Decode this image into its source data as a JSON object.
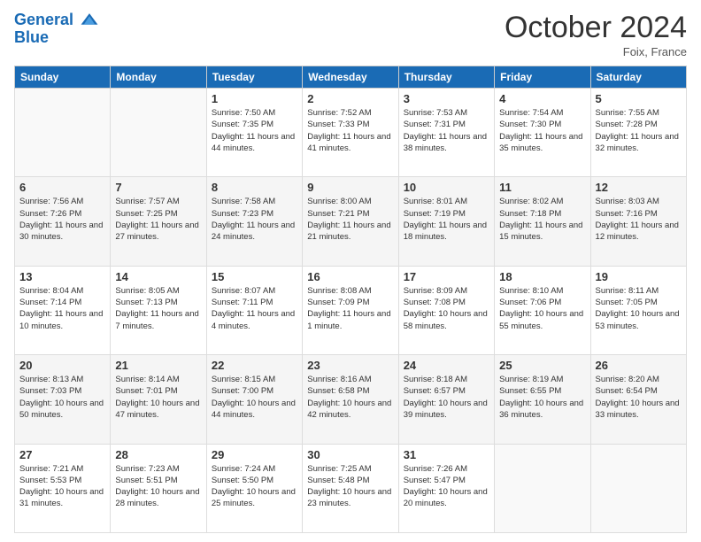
{
  "logo": {
    "line1": "General",
    "line2": "Blue"
  },
  "title": "October 2024",
  "location": "Foix, France",
  "days_of_week": [
    "Sunday",
    "Monday",
    "Tuesday",
    "Wednesday",
    "Thursday",
    "Friday",
    "Saturday"
  ],
  "weeks": [
    [
      {
        "day": "",
        "empty": true
      },
      {
        "day": "",
        "empty": true
      },
      {
        "day": "1",
        "sunrise": "Sunrise: 7:50 AM",
        "sunset": "Sunset: 7:35 PM",
        "daylight": "Daylight: 11 hours and 44 minutes."
      },
      {
        "day": "2",
        "sunrise": "Sunrise: 7:52 AM",
        "sunset": "Sunset: 7:33 PM",
        "daylight": "Daylight: 11 hours and 41 minutes."
      },
      {
        "day": "3",
        "sunrise": "Sunrise: 7:53 AM",
        "sunset": "Sunset: 7:31 PM",
        "daylight": "Daylight: 11 hours and 38 minutes."
      },
      {
        "day": "4",
        "sunrise": "Sunrise: 7:54 AM",
        "sunset": "Sunset: 7:30 PM",
        "daylight": "Daylight: 11 hours and 35 minutes."
      },
      {
        "day": "5",
        "sunrise": "Sunrise: 7:55 AM",
        "sunset": "Sunset: 7:28 PM",
        "daylight": "Daylight: 11 hours and 32 minutes."
      }
    ],
    [
      {
        "day": "6",
        "sunrise": "Sunrise: 7:56 AM",
        "sunset": "Sunset: 7:26 PM",
        "daylight": "Daylight: 11 hours and 30 minutes."
      },
      {
        "day": "7",
        "sunrise": "Sunrise: 7:57 AM",
        "sunset": "Sunset: 7:25 PM",
        "daylight": "Daylight: 11 hours and 27 minutes."
      },
      {
        "day": "8",
        "sunrise": "Sunrise: 7:58 AM",
        "sunset": "Sunset: 7:23 PM",
        "daylight": "Daylight: 11 hours and 24 minutes."
      },
      {
        "day": "9",
        "sunrise": "Sunrise: 8:00 AM",
        "sunset": "Sunset: 7:21 PM",
        "daylight": "Daylight: 11 hours and 21 minutes."
      },
      {
        "day": "10",
        "sunrise": "Sunrise: 8:01 AM",
        "sunset": "Sunset: 7:19 PM",
        "daylight": "Daylight: 11 hours and 18 minutes."
      },
      {
        "day": "11",
        "sunrise": "Sunrise: 8:02 AM",
        "sunset": "Sunset: 7:18 PM",
        "daylight": "Daylight: 11 hours and 15 minutes."
      },
      {
        "day": "12",
        "sunrise": "Sunrise: 8:03 AM",
        "sunset": "Sunset: 7:16 PM",
        "daylight": "Daylight: 11 hours and 12 minutes."
      }
    ],
    [
      {
        "day": "13",
        "sunrise": "Sunrise: 8:04 AM",
        "sunset": "Sunset: 7:14 PM",
        "daylight": "Daylight: 11 hours and 10 minutes."
      },
      {
        "day": "14",
        "sunrise": "Sunrise: 8:05 AM",
        "sunset": "Sunset: 7:13 PM",
        "daylight": "Daylight: 11 hours and 7 minutes."
      },
      {
        "day": "15",
        "sunrise": "Sunrise: 8:07 AM",
        "sunset": "Sunset: 7:11 PM",
        "daylight": "Daylight: 11 hours and 4 minutes."
      },
      {
        "day": "16",
        "sunrise": "Sunrise: 8:08 AM",
        "sunset": "Sunset: 7:09 PM",
        "daylight": "Daylight: 11 hours and 1 minute."
      },
      {
        "day": "17",
        "sunrise": "Sunrise: 8:09 AM",
        "sunset": "Sunset: 7:08 PM",
        "daylight": "Daylight: 10 hours and 58 minutes."
      },
      {
        "day": "18",
        "sunrise": "Sunrise: 8:10 AM",
        "sunset": "Sunset: 7:06 PM",
        "daylight": "Daylight: 10 hours and 55 minutes."
      },
      {
        "day": "19",
        "sunrise": "Sunrise: 8:11 AM",
        "sunset": "Sunset: 7:05 PM",
        "daylight": "Daylight: 10 hours and 53 minutes."
      }
    ],
    [
      {
        "day": "20",
        "sunrise": "Sunrise: 8:13 AM",
        "sunset": "Sunset: 7:03 PM",
        "daylight": "Daylight: 10 hours and 50 minutes."
      },
      {
        "day": "21",
        "sunrise": "Sunrise: 8:14 AM",
        "sunset": "Sunset: 7:01 PM",
        "daylight": "Daylight: 10 hours and 47 minutes."
      },
      {
        "day": "22",
        "sunrise": "Sunrise: 8:15 AM",
        "sunset": "Sunset: 7:00 PM",
        "daylight": "Daylight: 10 hours and 44 minutes."
      },
      {
        "day": "23",
        "sunrise": "Sunrise: 8:16 AM",
        "sunset": "Sunset: 6:58 PM",
        "daylight": "Daylight: 10 hours and 42 minutes."
      },
      {
        "day": "24",
        "sunrise": "Sunrise: 8:18 AM",
        "sunset": "Sunset: 6:57 PM",
        "daylight": "Daylight: 10 hours and 39 minutes."
      },
      {
        "day": "25",
        "sunrise": "Sunrise: 8:19 AM",
        "sunset": "Sunset: 6:55 PM",
        "daylight": "Daylight: 10 hours and 36 minutes."
      },
      {
        "day": "26",
        "sunrise": "Sunrise: 8:20 AM",
        "sunset": "Sunset: 6:54 PM",
        "daylight": "Daylight: 10 hours and 33 minutes."
      }
    ],
    [
      {
        "day": "27",
        "sunrise": "Sunrise: 7:21 AM",
        "sunset": "Sunset: 5:53 PM",
        "daylight": "Daylight: 10 hours and 31 minutes."
      },
      {
        "day": "28",
        "sunrise": "Sunrise: 7:23 AM",
        "sunset": "Sunset: 5:51 PM",
        "daylight": "Daylight: 10 hours and 28 minutes."
      },
      {
        "day": "29",
        "sunrise": "Sunrise: 7:24 AM",
        "sunset": "Sunset: 5:50 PM",
        "daylight": "Daylight: 10 hours and 25 minutes."
      },
      {
        "day": "30",
        "sunrise": "Sunrise: 7:25 AM",
        "sunset": "Sunset: 5:48 PM",
        "daylight": "Daylight: 10 hours and 23 minutes."
      },
      {
        "day": "31",
        "sunrise": "Sunrise: 7:26 AM",
        "sunset": "Sunset: 5:47 PM",
        "daylight": "Daylight: 10 hours and 20 minutes."
      },
      {
        "day": "",
        "empty": true
      },
      {
        "day": "",
        "empty": true
      }
    ]
  ]
}
